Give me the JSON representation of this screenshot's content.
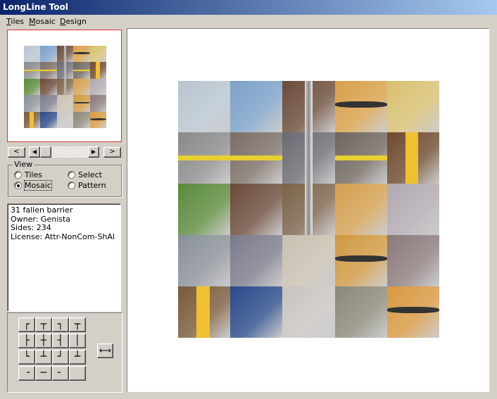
{
  "window": {
    "title": "LongLine Tool"
  },
  "menu": {
    "items": [
      {
        "label": "Tiles",
        "mnemonic": "T",
        "rest": "iles"
      },
      {
        "label": "Mosaic",
        "mnemonic": "M",
        "rest": "osaic"
      },
      {
        "label": "Design",
        "mnemonic": "D",
        "rest": "esign"
      }
    ]
  },
  "nav": {
    "prev_label": "<",
    "next_label": ">",
    "left_arrow": "◀",
    "right_arrow": "▶"
  },
  "view": {
    "group_label": "View",
    "options": [
      {
        "label": "Tiles",
        "selected": false
      },
      {
        "label": "Select",
        "selected": false
      },
      {
        "label": "Mosaic",
        "selected": true
      },
      {
        "label": "Pattern",
        "selected": false
      }
    ]
  },
  "info": {
    "name": "31 fallen barrier",
    "owner": "Owner: Genista",
    "sides": "Sides: 234",
    "license": "License: Attr-NonCom-ShAl"
  },
  "tile_buttons": [
    "┌",
    "┬",
    "┐",
    "┬",
    "├",
    "┼",
    "┤",
    "│",
    "└",
    "┴",
    "┘",
    "┴",
    "╶",
    "─",
    "╴",
    ""
  ],
  "swap_label": "⟷",
  "colors": {
    "accent": "#e03030",
    "title_start": "#0a246a",
    "title_end": "#a6caf0",
    "face": "#d4d0c8"
  },
  "mosaic": [
    "#b8c4d0",
    "#7ba0c8",
    "#6a4a38",
    "#d8a048",
    "#d8c070",
    "#8a8a8a",
    "#7a6e66",
    "#6a6a72",
    "#6e655e",
    "#6e4a2e",
    "#5a8a3a",
    "#6a4a3a",
    "#7a6248",
    "#d4a050",
    "#b0a8b0",
    "#8a9098",
    "#7a7a8a",
    "#c8c0b0",
    "#d09840",
    "#8a7a7a",
    "#7a5a3a",
    "#2a4a8a",
    "#c8c4c0",
    "#8a887a",
    "#d89840"
  ]
}
